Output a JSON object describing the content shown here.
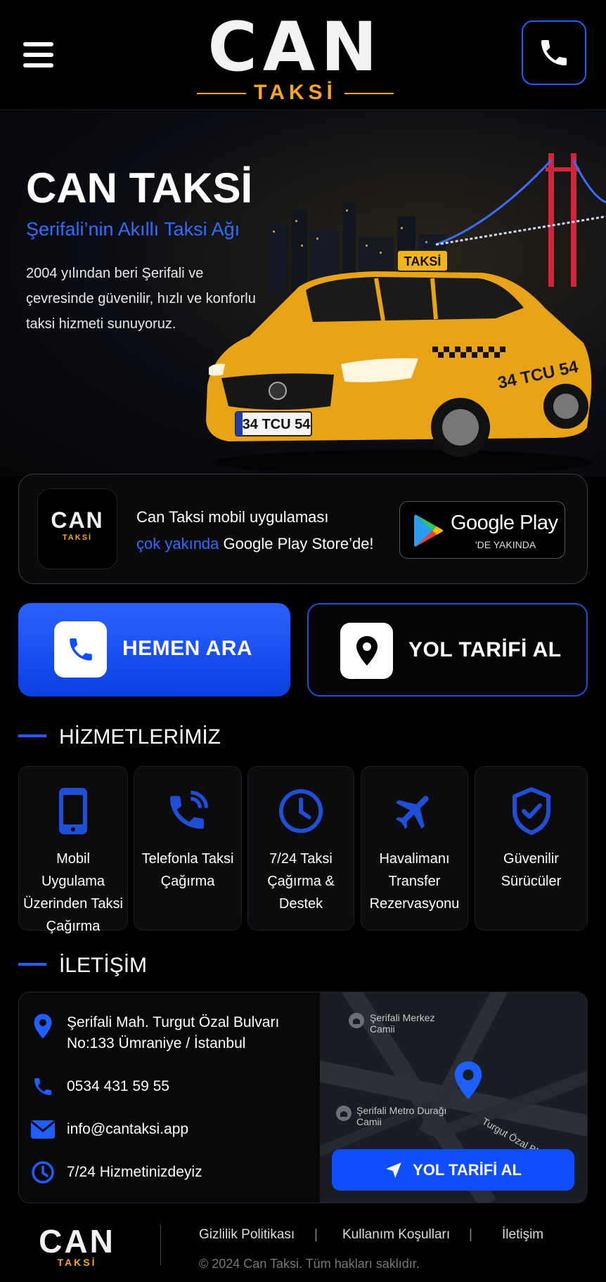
{
  "header": {
    "logo_main": "CAN",
    "logo_sub": "TAKSİ"
  },
  "hero": {
    "title": "CAN TAKSİ",
    "subtitle": "Şerifali’nin Akıllı Taksi Ağı",
    "description": "2004 yılından beri Şerifali ve çevresinde güvenilir, hızlı ve konforlu taksi hizmeti sunuyoruz.",
    "taxi_sign": "TAKSİ",
    "plate": "34 TCU 54",
    "door_plate": "34 TCU 54"
  },
  "app_banner": {
    "icon_main": "CAN",
    "icon_sub": "TAKSİ",
    "line1": "Can Taksi mobil uygulaması",
    "highlight": "çok yakında",
    "line2_rest": " Google Play Store’de!",
    "store_title": "Google Play",
    "store_sub": "'DE YAKINDA"
  },
  "actions": {
    "call_label": "HEMEN ARA",
    "directions_label": "YOL TARİFİ AL"
  },
  "services": {
    "title": "HİZMETLERİMİZ",
    "items": [
      {
        "label": "Mobil Uygulama Üzerinden Taksi Çağırma",
        "icon": "mobile-phone-icon"
      },
      {
        "label": "Telefonla Taksi Çağırma",
        "icon": "phone-call-icon"
      },
      {
        "label": "7/24 Taksi Çağırma & Destek",
        "icon": "clock-icon"
      },
      {
        "label": "Havalimanı Transfer Rezervasyonu",
        "icon": "airplane-icon"
      },
      {
        "label": "Güvenilir Sürücüler",
        "icon": "shield-check-icon"
      }
    ]
  },
  "contact": {
    "title": "İLETİŞİM",
    "address": "Şerifali Mah. Turgut Özal Bulvarı No:133 Ümraniye / İstanbul",
    "phone": "0534 431 59 55",
    "email": "info@cantaksi.app",
    "hours": "7/24 Hizmetinizdeyiz",
    "map": {
      "poi1": "Şerifali Merkez Camii",
      "poi2": "Şerifali Metro Durağı Camii",
      "street": "Turgut Özal Blv.",
      "button": "YOL TARİFİ AL"
    }
  },
  "footer": {
    "logo_main": "CAN",
    "logo_sub": "TAKSİ",
    "links": [
      "Gizlilik Politikası",
      "Kullanım Koşulları",
      "İletişim"
    ],
    "copyright": "© 2024 Can Taksi. Tüm hakları saklıdır."
  },
  "colors": {
    "accent": "#1f5eff",
    "brand_orange": "#f5a623",
    "taxi_yellow": "#e8a316"
  }
}
